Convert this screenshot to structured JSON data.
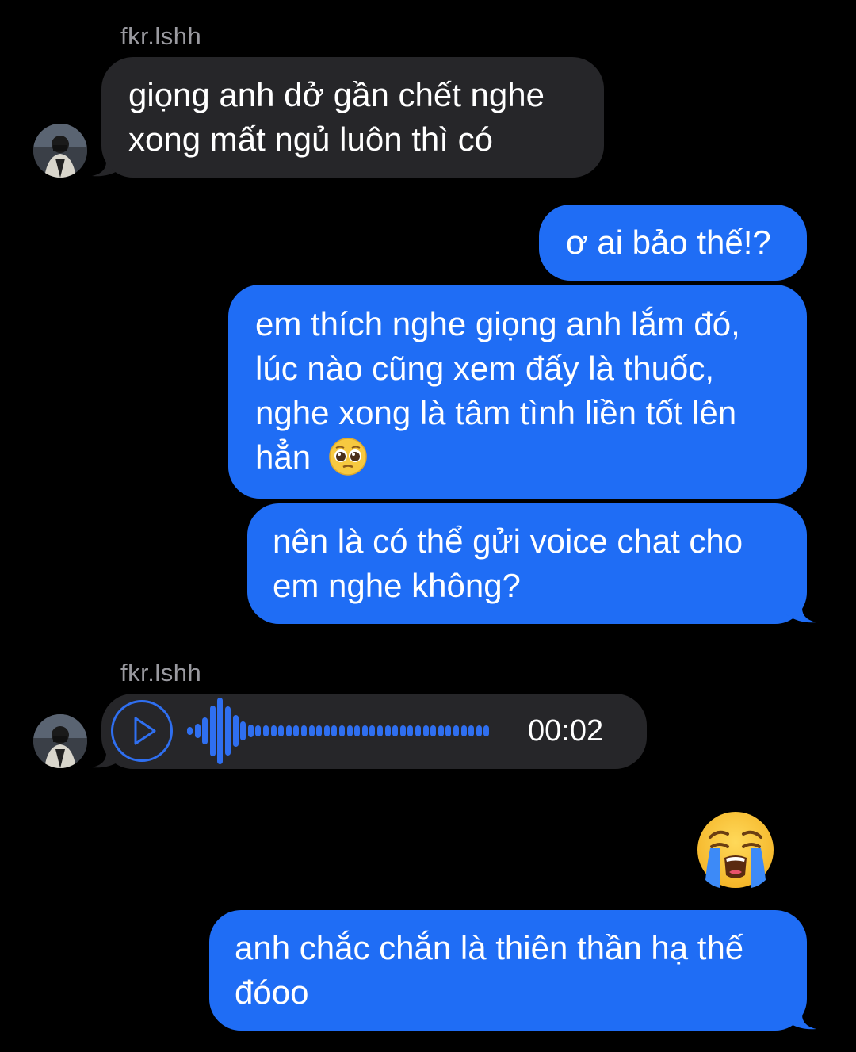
{
  "messages": [
    {
      "sender": "fkr.lshh",
      "direction": "incoming",
      "lines": [
        "giọng anh dở gần chết nghe",
        "xong mất ngủ luôn thì có"
      ]
    },
    {
      "direction": "outgoing",
      "lines": [
        "ơ ai bảo thế!?"
      ]
    },
    {
      "direction": "outgoing",
      "lines": [
        "em thích nghe giọng anh lắm đó,",
        "lúc nào cũng xem đấy là thuốc,",
        "nghe xong là tâm tình liền tốt lên",
        "hẳn"
      ],
      "trailing_emoji": "pleading-face"
    },
    {
      "direction": "outgoing",
      "lines": [
        "nên là có thể gửi voice chat cho",
        "em nghe không?"
      ]
    },
    {
      "sender": "fkr.lshh",
      "direction": "incoming",
      "type": "voice",
      "duration": "00:02"
    },
    {
      "direction": "outgoing",
      "type": "emoji",
      "emoji": "loudly-crying-face"
    },
    {
      "direction": "outgoing",
      "lines": [
        "anh chắc chắn là thiên thần hạ thế",
        "đóoo"
      ]
    }
  ],
  "colors": {
    "background": "#000000",
    "incoming_bubble": "#262629",
    "outgoing_bubble": "#1f6df5",
    "voice_accent": "#2f6ff0",
    "sender_name": "#9a9aa0"
  }
}
